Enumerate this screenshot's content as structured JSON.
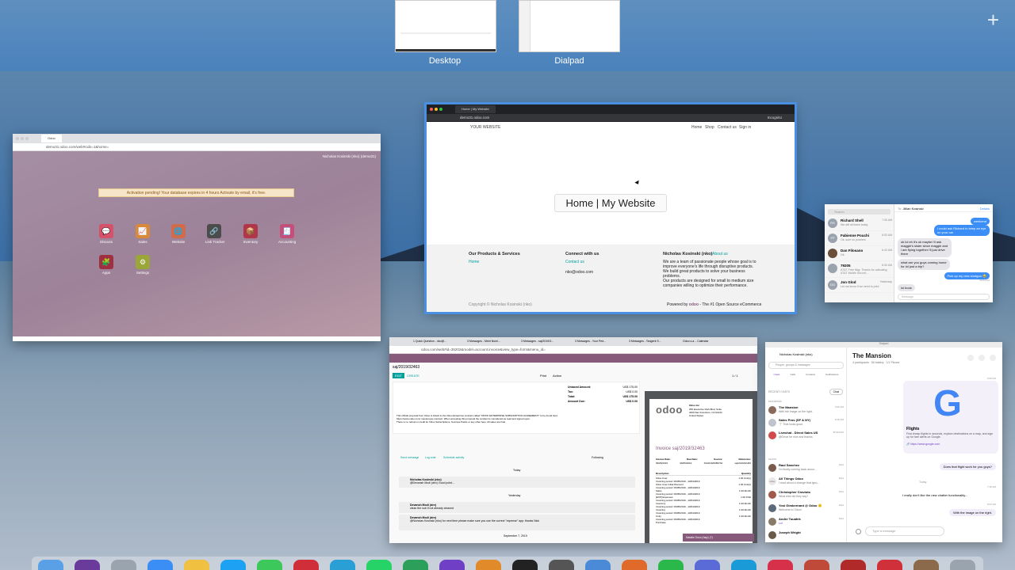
{
  "spaces": [
    {
      "label": "Desktop"
    },
    {
      "label": "Dialpad"
    }
  ],
  "add_space_label": "+",
  "odoo_window": {
    "tab_title": "Odoo",
    "url": "demo31.odoo.com/web#cids=1&home=",
    "user": "Nicholas Kosinski (nko) (demo31)",
    "banner": "Activation pending! Your database expires in 4 hours Activate by email, it's free.",
    "apps": [
      "Discuss",
      "Sales",
      "Website",
      "Link Tracker",
      "Inventory",
      "Accounting",
      "Apps",
      "Settings"
    ]
  },
  "website_window": {
    "tab_title": "Home | My Website",
    "url": "demo31.odoo.com",
    "incognito": "Incognito",
    "logo": "YOUR WEBSITE",
    "nav": [
      "Home",
      "Shop",
      "Contact us",
      "Sign in"
    ],
    "hero_title": "Home | My Website",
    "footer": {
      "col1_title": "Our Products & Services",
      "col1_link": "Home",
      "col2_title": "Connect with us",
      "col2_link": "Contact us",
      "col2_email": "nko@odoo.com",
      "col3_title": "Nicholas Kosinski (nko)",
      "col3_about": "About us",
      "col3_text1": "We are a team of passionate people whose goal is to improve everyone's life through disruptive products. We build great products to solve your business problems.",
      "col3_text2": "Our products are designed for small to medium size companies willing to optimize their performance.",
      "copyright": "Copyright © Nicholas Kosinski (nko)",
      "powered": "Powered by",
      "brand": "odoo",
      "powered_rest": "- The #1 Open Source eCommerce"
    }
  },
  "messages_window": {
    "search_placeholder": "Search",
    "to_label": "To:",
    "to_value": "Jillian Kosinski",
    "details": "Details",
    "conversations": [
      {
        "initials": "RS",
        "name": "Richard Shell",
        "time": "7:06 AM",
        "preview": "We will all leave today"
      },
      {
        "initials": "FP",
        "name": "Fabienne Pouchi",
        "time": "6:53 AM",
        "preview": "Ok, sure no problem"
      },
      {
        "initials": "",
        "name": "Dan Filosano",
        "time": "6:42 AM",
        "preview": "Ok"
      },
      {
        "initials": "",
        "name": "79205",
        "time": "6:30 AM",
        "preview": "AT&T Free Msg: Thanks for activating AT&T Mobile Securit..."
      },
      {
        "initials": "DG",
        "name": "Jon Glod",
        "time": "Yesterday",
        "preview": "Let me know if we need to print"
      }
    ],
    "bubbles": [
      {
        "text": "weekend",
        "mine": true
      },
      {
        "text": "I could ask Richard to keep an eye on your car",
        "mine": true
      },
      {
        "text": "ok lol eh it's ok maybe i'll ask maggie's sister since maggie and i are flying together i'll just drive there",
        "mine": false
      },
      {
        "text": "what are you guys coming home for lol just a trip?",
        "mine": false
      },
      {
        "text": "Pick up my new shotgun 😂",
        "mine": true
      },
      {
        "text": "lol boos",
        "mine": false
      }
    ],
    "delivered": "Delivered",
    "input_placeholder": "iMessage"
  },
  "invoice_window": {
    "tabs": [
      "1 Quick Question - nko@...",
      "3 Messages - Meet Nomi...",
      "3 Messages - saj/2019/3...",
      "3 Messages - Your Ped...",
      "3 Messages - Tangent S...",
      "Odoo s.a. - Calendar"
    ],
    "url": "odoo.com/web#id=36202&model=account.invoice&view_type=form&menu_id=",
    "record": "saj/2019/32463",
    "edit": "EDIT",
    "create": "CREATE",
    "print": "Print",
    "action": "Action",
    "pager": "1 / 1",
    "totals": [
      {
        "label": "Untaxed Amount:",
        "value": "US$ 175.00"
      },
      {
        "label": "Tax:",
        "value": "US$ 0.00"
      },
      {
        "label": "Total:",
        "value": "US$ 175.00"
      },
      {
        "label": "Amount Due:",
        "value": "US$ 0.00"
      }
    ],
    "note1": "This official proposal from Odoo is linked to the Odoo Enterprise contract called \"ODOO ENTERPRISE SUBSCRIPTION AGREEMENT\" to be found here:",
    "note2": "https://www.odoo.com/ meetproper-contract. When accepting this proposal the contract is considered as read and signed upon.",
    "note3": "There is no refund or credit for Odoo Subscriptions, Success Packs or any other fees. All sales are final.",
    "chatter_actions": [
      "Send message",
      "Log note",
      "Schedule activity"
    ],
    "following": "Following",
    "days": [
      "Today",
      "Yesterday",
      "September 7, 2019"
    ],
    "chatter": [
      {
        "author": "Nicholas Kosinski (nko)",
        "text": "@Devansh Modi (dev) Good point..."
      },
      {
        "author": "Devansh Modi (dev)",
        "text": "clean the sub if not already cleaned"
      },
      {
        "author": "Devansh Modi (dev)",
        "text": "@Nicholas Kosinski (nko) for next time please make sure you use the correct \"expense\" app: thanks Nick"
      }
    ],
    "pdf": {
      "brand": "odoo",
      "company": "Odoo Inc",
      "address": "250 Executive Park Blvd, Suite 3400 San Francisco, CA 94134 United States",
      "title": "Invoice saj/2019/32463",
      "cols": [
        "Invoice Date:",
        "Due Date:",
        "Source:",
        "Reference:"
      ],
      "vals": [
        "09/05/2019",
        "09/05/2019",
        "SO2019/0089702",
        "saj/2019/32463"
      ],
      "desc_header": "Description",
      "qty_header": "Quantity",
      "lines": [
        {
          "desc": "Odoo User",
          "qty": "1.00 Unit(s)"
        },
        {
          "desc": "Odoo User Initial Discount",
          "qty": "1.00 Unit(s)"
        },
        {
          "desc": "Sales",
          "qty": "1.00 Month"
        },
        {
          "desc": "[EXP] Expenses",
          "qty": "1.00 PCE"
        },
        {
          "desc": "Inventory",
          "qty": "1.00 Month"
        },
        {
          "desc": "Invoicing",
          "qty": "1.00 Month"
        },
        {
          "desc": "Unity",
          "qty": "1.00 Month"
        },
        {
          "desc": "Purchase",
          "qty": ""
        }
      ],
      "period": "Invoicing period: 09/05/2019 - 10/04/2019",
      "chat_chip": "Natalie Dora (hap) (?)"
    }
  },
  "dialpad_window": {
    "title": "Dialpad",
    "user": "Nicholas Kosinski (nko)",
    "search_placeholder": "People, groups & messages",
    "nav": [
      "Chats",
      "Calls",
      "Contacts",
      "Notifications"
    ],
    "recent_label": "RECENT CHATS",
    "chat_button": "Chat",
    "favorites_label": "FAVORITES",
    "chats_label": "CHATS",
    "favorites": [
      {
        "name": "The Mansion",
        "time": "9:06 AM",
        "preview": "With the image on the right."
      },
      {
        "name": "Sales Pros (SF & NY)",
        "time": "8:38 AM",
        "preview": "🍸 That looks good"
      },
      {
        "name": "Livechat - Direct Sales US",
        "time": "8/19/2019",
        "preview": "@Omar be nice and thanks"
      }
    ],
    "chats": [
      {
        "name": "Raul Sanchez",
        "time": "Wed",
        "preview": "I'm finally coming back aroun..."
      },
      {
        "name": "All Things Odoo",
        "time": "Wed",
        "preview": "I read about a change that igno..."
      },
      {
        "name": "Christopher Cravioto",
        "time": "Wed",
        "preview": "What else did they say?"
      },
      {
        "name": "Yosi Gimbernard @ Odoo 🙂",
        "time": "Wed",
        "preview": "Welcome to Odoo!"
      },
      {
        "name": "Andre Touafek",
        "time": "Wed",
        "preview": "Lol"
      },
      {
        "name": "Joseph Wright",
        "time": "",
        "preview": ""
      }
    ],
    "room_title": "The Mansion",
    "room_meta": "4 participants · 56 battery · 1/1 Pinned",
    "link_title": "Flights",
    "link_text": "Find cheap flights in seconds, explore destinations on a map, and sign up for fare alerts on Google.",
    "link_url": "🔗 https://www.google.com",
    "messages": [
      {
        "text": "Does that flight work for you guys?",
        "time": "6:56 PM",
        "mine": true
      },
      {
        "text": "I really don't like the new chatter functionality...",
        "time": "7:38 AM",
        "mine": false
      },
      {
        "text": "With the image on the right.",
        "time": "8:54 AM",
        "mine": true
      }
    ],
    "day_sep": "Today",
    "input_placeholder": "Type a message"
  },
  "colors": {
    "odoo_purple": "#875a7b",
    "dialpad_purple": "#6f3fc6",
    "imessage_blue": "#3a8ef6",
    "odoo_teal": "#00a09d"
  }
}
